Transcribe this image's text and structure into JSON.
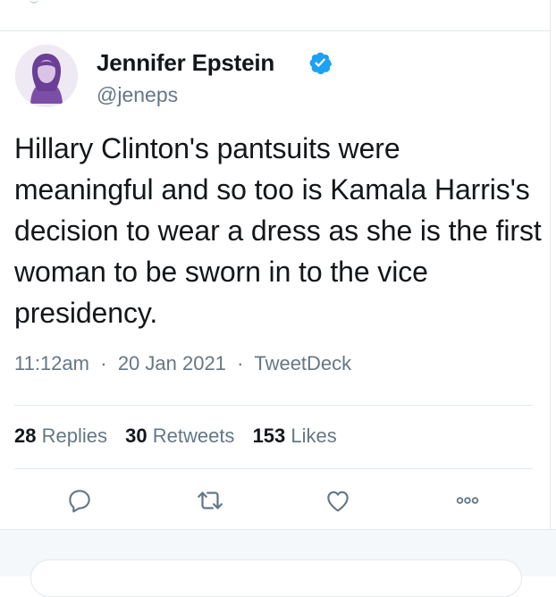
{
  "tweet": {
    "author_name": "Jennifer Epstein",
    "author_handle": "@jeneps",
    "verified": true,
    "text": "Hillary Clinton's pantsuits were meaningful and so too is Kamala Harris's decision to wear a dress as she is the first woman to be sworn in to the vice presidency.",
    "time": "11:12am",
    "date": "20 Jan 2021",
    "source": "TweetDeck",
    "separator": "·"
  },
  "stats": {
    "replies_count": "28",
    "replies_label": "Replies",
    "retweets_count": "30",
    "retweets_label": "Retweets",
    "likes_count": "153",
    "likes_label": "Likes"
  },
  "actions": [
    "reply-icon",
    "retweet-icon",
    "like-icon",
    "more-icon"
  ],
  "colors": {
    "text": "#14171a",
    "secondary": "#657786",
    "verified": "#1da1f2",
    "divider": "#e1e8ed",
    "avatar_accent": "#7b4fa6"
  }
}
